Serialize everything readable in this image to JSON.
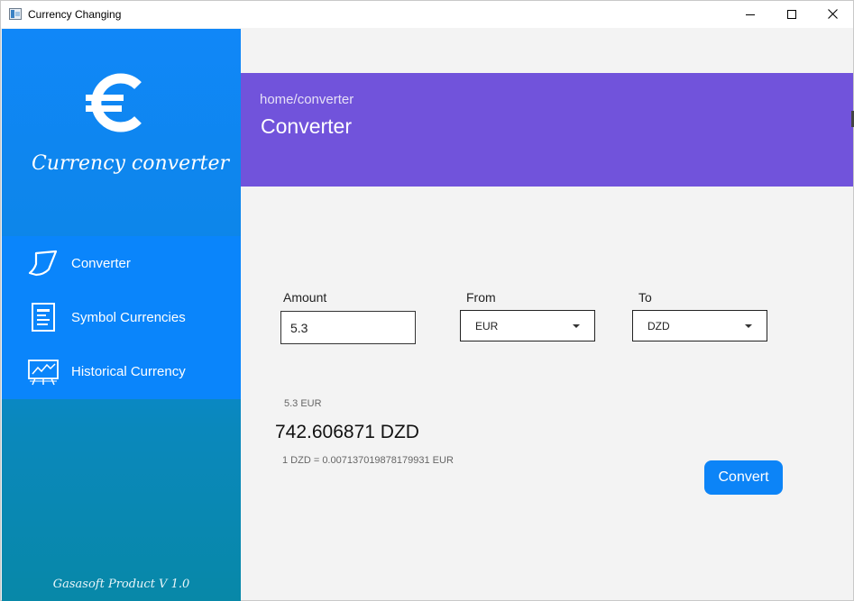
{
  "window": {
    "title": "Currency Changing"
  },
  "sidebar": {
    "title": "Currency converter",
    "footer": "Gasasoft Product V 1.0",
    "items": [
      {
        "label": "Converter",
        "icon": "note-icon"
      },
      {
        "label": "Symbol Currencies",
        "icon": "document-icon"
      },
      {
        "label": "Historical Currency",
        "icon": "chart-board-icon"
      }
    ]
  },
  "header": {
    "breadcrumb": "home/converter",
    "title": "Converter"
  },
  "form": {
    "amount_label": "Amount",
    "amount_value": "5.3",
    "from_label": "From",
    "from_value": "EUR",
    "to_label": "To",
    "to_value": "DZD",
    "convert_label": "Convert"
  },
  "output": {
    "from_amount": "5.3 EUR",
    "result": "742.606871 DZD",
    "rate": "1 DZD = 0.007137019878179931 EUR"
  },
  "colors": {
    "sidebar_top": "#1087f8",
    "sidebar_bottom": "#0888a8",
    "header": "#7153db",
    "accent": "#0c84f7"
  }
}
